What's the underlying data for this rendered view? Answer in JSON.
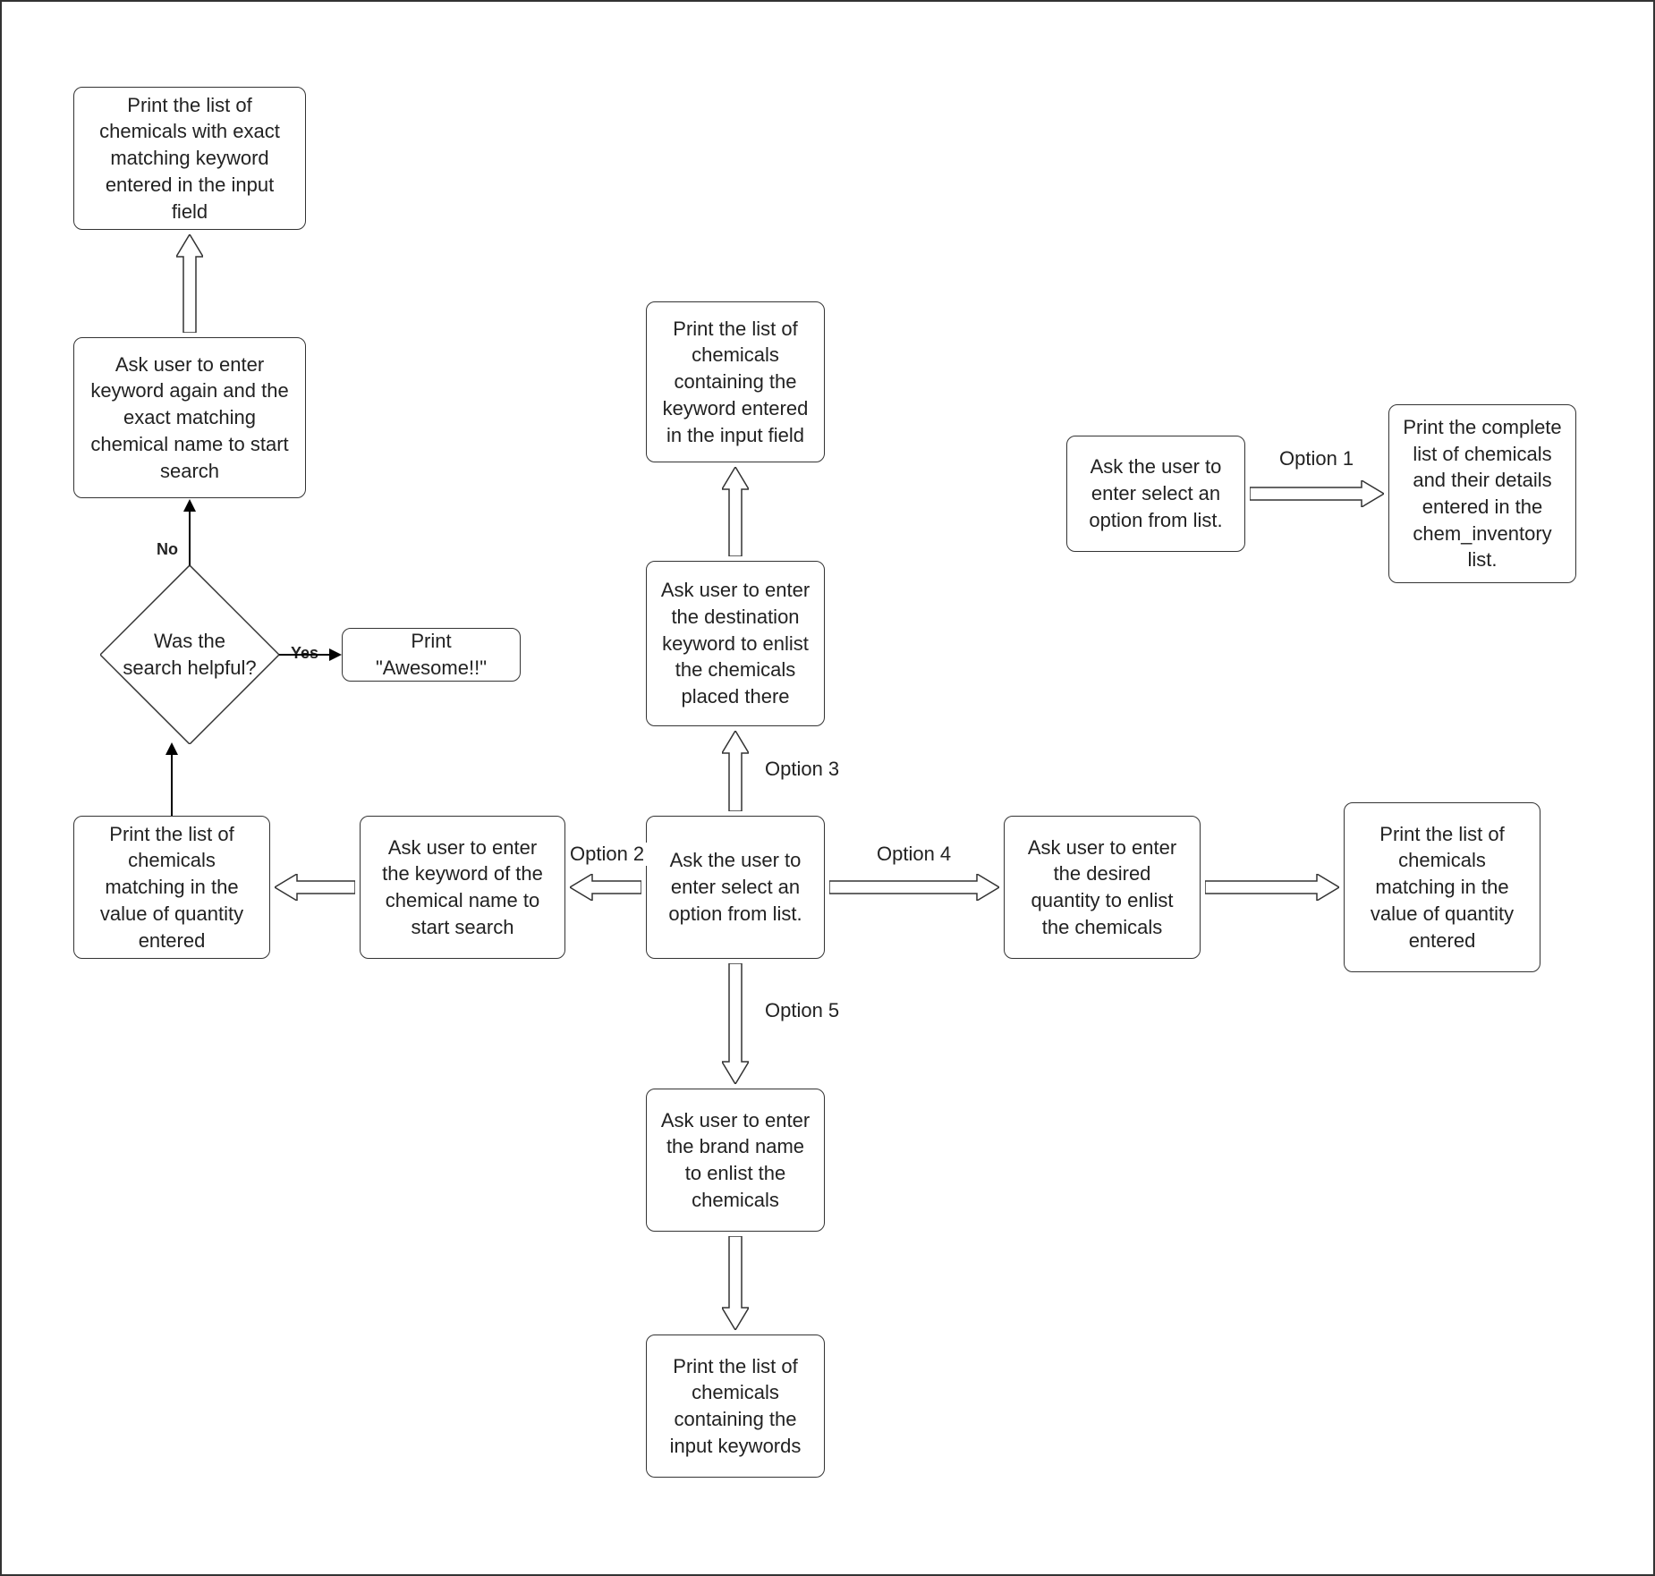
{
  "nodes": {
    "n1": "Print the list of chemicals with exact matching keyword entered in the input field",
    "n2": "Ask user to enter keyword again and the exact matching chemical name to start search",
    "decision": "Was the search helpful?",
    "n_awesome": "Print \"Awesome!!\"",
    "n_qty_left": "Print the list of chemicals matching in the value of quantity entered",
    "n_opt2": "Ask user to enter the keyword  of the chemical name to start search",
    "center": "Ask the user to enter select an option from list.",
    "n_opt3a": "Ask user to enter the destination keyword to enlist the chemicals placed there",
    "n_opt3b": "Print the list of chemicals containing the keyword entered in the input field",
    "n_opt4a": "Ask user to enter the desired quantity to enlist the chemicals",
    "n_opt4b": "Print the list of chemicals matching in the value of quantity entered",
    "n_opt5a": "Ask user to enter the brand name to enlist the chemicals",
    "n_opt5b": "Print the list of chemicals containing the input keywords",
    "n_opt1a": "Ask the user to enter select an option from list.",
    "n_opt1b": "Print the complete list of chemicals and their details entered in the chem_inventory list."
  },
  "labels": {
    "no": "No",
    "yes": "Yes",
    "opt1": "Option 1",
    "opt2": "Option 2",
    "opt3": "Option 3",
    "opt4": "Option 4",
    "opt5": "Option 5"
  }
}
